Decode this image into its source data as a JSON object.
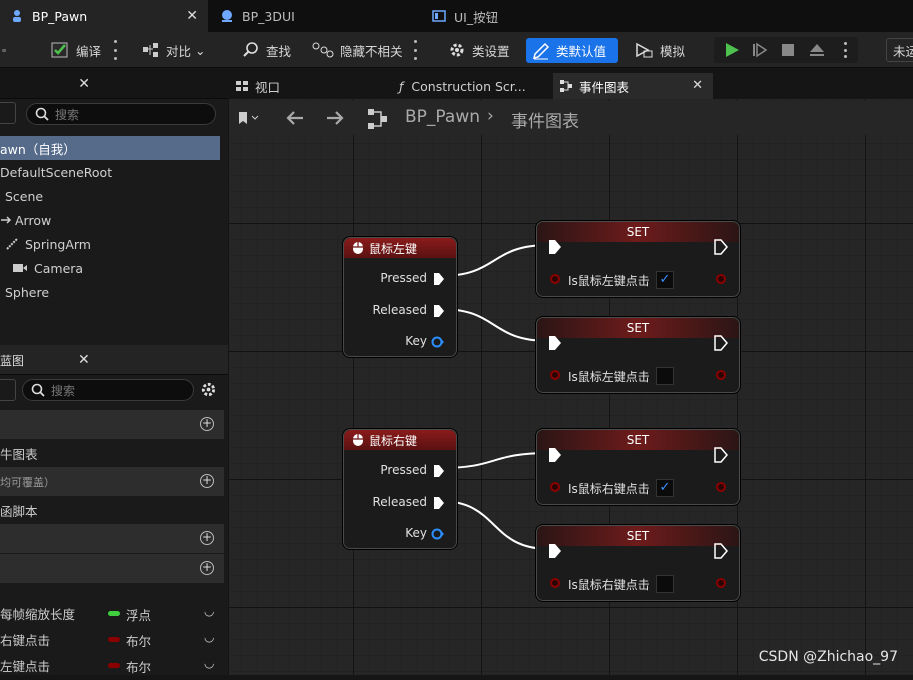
{
  "tabs": [
    {
      "label": "BP_Pawn",
      "active": true
    },
    {
      "label": "BP_3DUI",
      "active": false
    },
    {
      "label": "UI_按钮",
      "active": false
    }
  ],
  "toolbar": {
    "compile": "编译",
    "diff": "对比",
    "find": "查找",
    "hide_unrelated": "隐藏不相关",
    "class_settings": "类设置",
    "class_defaults": "类默认值",
    "simulate": "模拟",
    "right_cut": "未运"
  },
  "components_panel": {
    "search_placeholder": "搜索",
    "items": [
      "awn（自我）",
      "DefaultSceneRoot",
      "Scene",
      "Arrow",
      "SpringArm",
      "Camera",
      "Sphere"
    ]
  },
  "blueprint_panel": {
    "title": "蓝图",
    "search_placeholder": "搜索",
    "sections": [
      "牛图表",
      "均可覆盖）",
      "函脚本"
    ],
    "variables": [
      {
        "name": "每帧缩放长度",
        "type": "浮点",
        "color": "#3fcf3f"
      },
      {
        "name": "右键点击",
        "type": "布尔",
        "color": "#8b0000"
      },
      {
        "name": "左键点击",
        "type": "布尔",
        "color": "#8b0000"
      }
    ]
  },
  "graph_tabs": [
    {
      "label": "视口",
      "active": false
    },
    {
      "label": "Construction Scr...",
      "active": false
    },
    {
      "label": "事件图表",
      "active": true
    }
  ],
  "breadcrumb": {
    "root": "BP_Pawn",
    "current": "事件图表"
  },
  "nodes": {
    "left_mouse": {
      "title": "鼠标左键",
      "pressed": "Pressed",
      "released": "Released",
      "key": "Key"
    },
    "right_mouse": {
      "title": "鼠标右键",
      "pressed": "Pressed",
      "released": "Released",
      "key": "Key"
    },
    "set_title": "SET",
    "set1": {
      "var": "Is鼠标左键点击",
      "checked": true
    },
    "set2": {
      "var": "Is鼠标左键点击",
      "checked": false
    },
    "set3": {
      "var": "Is鼠标右键点击",
      "checked": true
    },
    "set4": {
      "var": "Is鼠标右键点击",
      "checked": false
    }
  },
  "watermark": "CSDN @Zhichao_97",
  "colors": {
    "accent": "#1a73e8",
    "bool_pin": "#8b0000",
    "float_pin": "#3fcf3f",
    "node_head_red": "#7a1717"
  }
}
